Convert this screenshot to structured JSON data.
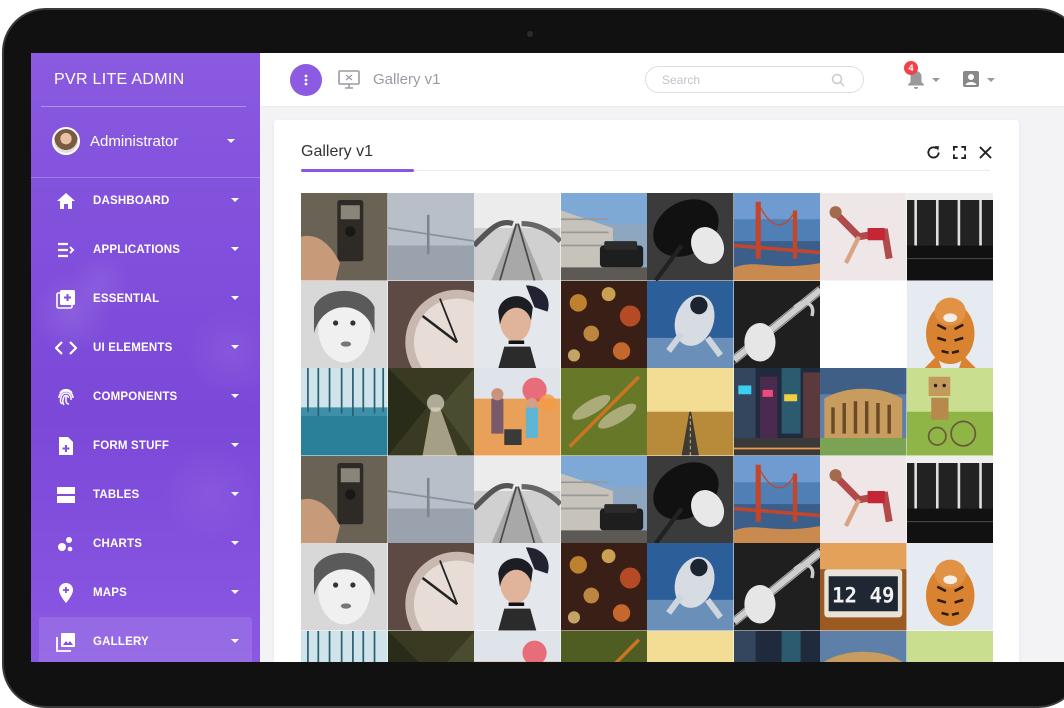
{
  "app": {
    "brand": "PVR  LITE ADMIN"
  },
  "user": {
    "name": "Administrator"
  },
  "nav": [
    {
      "label": "DASHBOARD",
      "icon": "home-icon"
    },
    {
      "label": "APPLICATIONS",
      "icon": "list-icon"
    },
    {
      "label": "ESSENTIAL",
      "icon": "add-box-icon"
    },
    {
      "label": "UI ELEMENTS",
      "icon": "code-icon"
    },
    {
      "label": "COMPONENTS",
      "icon": "fingerprint-icon"
    },
    {
      "label": "FORM STUFF",
      "icon": "note-add-icon"
    },
    {
      "label": "TABLES",
      "icon": "table-icon"
    },
    {
      "label": "CHARTS",
      "icon": "bubble-chart-icon"
    },
    {
      "label": "MAPS",
      "icon": "place-icon"
    },
    {
      "label": "GALLERY",
      "icon": "photo-library-icon",
      "active": true
    }
  ],
  "topbar": {
    "title": "Gallery v1",
    "search_placeholder": "Search",
    "notification_count": "4"
  },
  "card": {
    "title": "Gallery v1"
  },
  "gallery": {
    "images": [
      "hand-with-camera",
      "foggy-bridge",
      "railroad-tracks",
      "black-suv",
      "desk-lamp",
      "golden-gate-bridge",
      "dancer",
      "dark-windows",
      "woman-face-bw",
      "vintage-clock",
      "woman-portrait",
      "bokeh-lights",
      "astronaut",
      "guitar-player",
      "blank",
      "tiger-in-snow",
      "blue-forest",
      "forest-path",
      "kids-bubbles",
      "dragonfly",
      "desert-road",
      "city-street",
      "colosseum",
      "cardboard-robot",
      "hand-with-camera",
      "foggy-bridge",
      "railroad-tracks",
      "black-suv",
      "desk-lamp",
      "golden-gate-bridge",
      "dancer",
      "dark-windows",
      "woman-face-bw",
      "vintage-clock",
      "woman-portrait",
      "bokeh-lights",
      "astronaut",
      "guitar-player",
      "flip-clock",
      "tiger-in-snow",
      "blue-forest",
      "forest-path",
      "kids-bubbles",
      "dragonfly",
      "desert-road",
      "city-street",
      "colosseum",
      "cardboard-robot"
    ],
    "flip_clock_digits": "12 49"
  }
}
